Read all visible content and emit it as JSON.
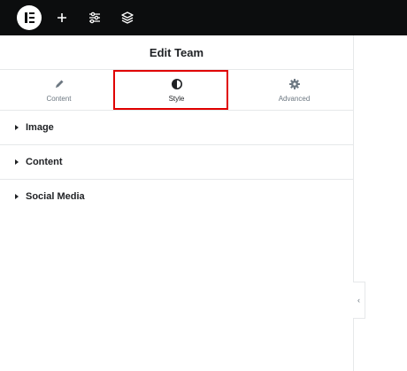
{
  "topbar": {
    "logo_icon": "elementor-logo",
    "icons": [
      "add-element-icon",
      "site-settings-icon",
      "structure-layers-icon"
    ]
  },
  "panel": {
    "title": "Edit Team",
    "tabs": [
      {
        "label": "Content",
        "icon": "pencil-icon"
      },
      {
        "label": "Style",
        "icon": "half-circle-contrast-icon",
        "active": true
      },
      {
        "label": "Advanced",
        "icon": "gear-icon"
      }
    ],
    "highlight_color": "#e00000",
    "sections": [
      {
        "label": "Image"
      },
      {
        "label": "Content"
      },
      {
        "label": "Social Media"
      }
    ]
  },
  "collapse_handle": {
    "glyph": "‹"
  }
}
